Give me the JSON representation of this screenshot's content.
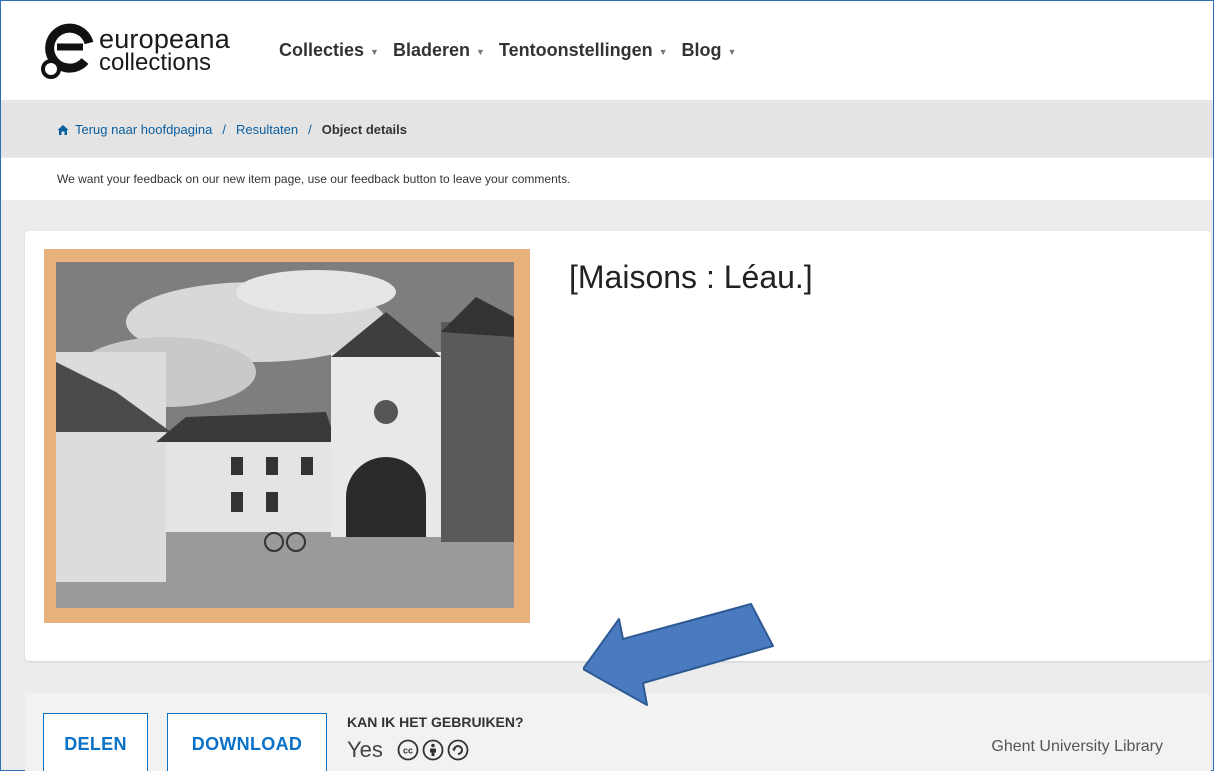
{
  "header": {
    "logo": {
      "line1": "europeana",
      "line2": "collections"
    },
    "nav": [
      {
        "label": "Collecties"
      },
      {
        "label": "Bladeren"
      },
      {
        "label": "Tentoonstellingen"
      },
      {
        "label": "Blog"
      }
    ]
  },
  "breadcrumb": {
    "home_label": "Terug naar hoofdpagina",
    "separator": "/",
    "results_label": "Resultaten",
    "current_label": "Object details"
  },
  "feedback": {
    "message": "We want your feedback on our new item page, use our feedback button to leave your comments."
  },
  "item": {
    "title": "[Maisons : Léau.]"
  },
  "actions": {
    "share_label": "DELEN",
    "download_label": "DOWNLOAD"
  },
  "rights": {
    "heading": "KAN IK HET GEBRUIKEN?",
    "value": "Yes",
    "icons": [
      "cc-icon",
      "attribution-icon",
      "share-alike-icon"
    ]
  },
  "provider": {
    "name": "Ghent University Library"
  },
  "colors": {
    "link": "#0a5e9e",
    "button_accent": "#0a72c6",
    "image_mat": "#e8b07c",
    "arrow": "#4a7ac0"
  }
}
